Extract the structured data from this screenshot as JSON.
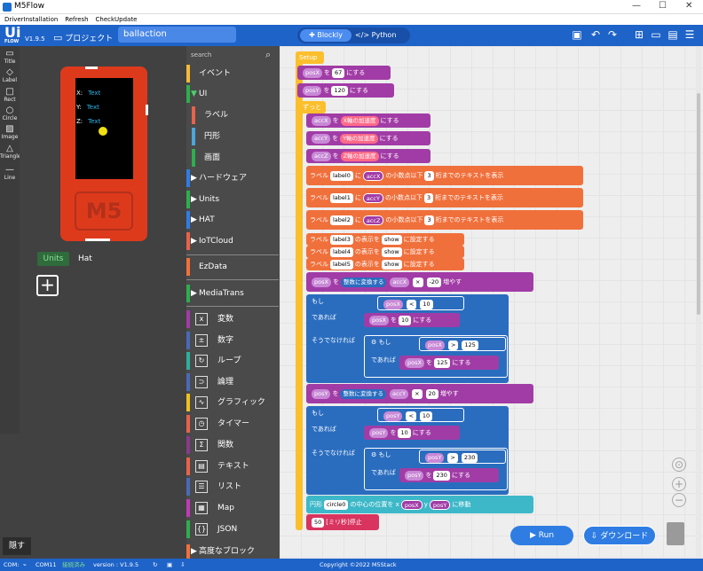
{
  "window": {
    "title": "M5Flow",
    "min": "—",
    "max": "☐",
    "close": "✕"
  },
  "menu": [
    "DriverInstallation",
    "Refresh",
    "CheckUpdate"
  ],
  "header": {
    "logo": "Ui",
    "logo_sub": "FLOW",
    "version": "V1.9.5",
    "project_label": "プロジェクト",
    "project_name": "ballaction",
    "blockly": "Blockly",
    "python": "Python"
  },
  "tools": [
    "Title",
    "Label",
    "Rect",
    "Circle",
    "Image",
    "Triangle",
    "Line"
  ],
  "device": {
    "labels": [
      {
        "k": "X:",
        "v": "Text"
      },
      {
        "k": "Y:",
        "v": "Text"
      },
      {
        "k": "Z:",
        "v": "Text"
      }
    ],
    "brand": "M5"
  },
  "tabs": {
    "units": "Units",
    "hat": "Hat"
  },
  "hide_label": "隠す",
  "search_placeholder": "search",
  "categories": [
    {
      "label": "イベント",
      "color": "#f5b83a"
    },
    {
      "label": "UI",
      "color": "#2fae4d",
      "expand": "▼"
    },
    {
      "label": "ラベル",
      "color": "#e8634a",
      "sub": true
    },
    {
      "label": "円形",
      "color": "#4ea6d9",
      "sub": true
    },
    {
      "label": "画面",
      "color": "#2fae4d",
      "sub": true
    },
    {
      "label": "ハードウェア",
      "color": "#2f7de3",
      "expand": "▶"
    },
    {
      "label": "Units",
      "color": "#2fae4d",
      "expand": "▶"
    },
    {
      "label": "HAT",
      "color": "#2f7de3",
      "expand": "▶"
    },
    {
      "label": "IoTCloud",
      "color": "#e8634a",
      "expand": "▶"
    },
    {
      "label": "EzData",
      "color": "#f0703c"
    },
    {
      "label": "MediaTrans",
      "color": "#2fae4d",
      "expand": "▶"
    },
    {
      "label": "変数",
      "color": "#a13ca6",
      "icon": "x"
    },
    {
      "label": "数字",
      "color": "#4a6ab8",
      "icon": "±"
    },
    {
      "label": "ループ",
      "color": "#2fae9c",
      "icon": "↻"
    },
    {
      "label": "論理",
      "color": "#4a6ab8",
      "icon": "⊃"
    },
    {
      "label": "グラフィック",
      "color": "#f0c020",
      "icon": "∿"
    },
    {
      "label": "タイマー",
      "color": "#e8634a",
      "icon": "◷"
    },
    {
      "label": "関数",
      "color": "#8a3a8a",
      "icon": "Σ"
    },
    {
      "label": "テキスト",
      "color": "#e8634a",
      "icon": "▤"
    },
    {
      "label": "リスト",
      "color": "#4a6ab8",
      "icon": "☰"
    },
    {
      "label": "Map",
      "color": "#c03ab8",
      "icon": "▦"
    },
    {
      "label": "JSON",
      "color": "#2fae4d",
      "icon": "{}"
    },
    {
      "label": "高度なブロック",
      "color": "#f0703c",
      "expand": "▶"
    }
  ],
  "blocks": {
    "setup": "Setup",
    "posX_init": {
      "var": "posX",
      "op": "を",
      "val": "67",
      "act": "にする"
    },
    "posY_init": {
      "var": "posY",
      "op": "を",
      "val": "120",
      "act": "にする"
    },
    "loop": "ずっと",
    "acc": [
      {
        "var": "accX",
        "op": "を",
        "val": "X軸の加速度",
        "act": "にする"
      },
      {
        "var": "accY",
        "op": "を",
        "val": "Y軸の加速度",
        "act": "にする"
      },
      {
        "var": "accZ",
        "op": "を",
        "val": "Z軸の加速度",
        "act": "にする"
      }
    ],
    "label_set": [
      {
        "pre": "ラベル",
        "name": "label0",
        "ni": "に",
        "v": "accX",
        "mid": "の小数点以下",
        "n": "3",
        "post": "桁までのテキスト",
        "end": "を表示"
      },
      {
        "pre": "ラベル",
        "name": "label1",
        "ni": "に",
        "v": "accY",
        "mid": "の小数点以下",
        "n": "3",
        "post": "桁までのテキスト",
        "end": "を表示"
      },
      {
        "pre": "ラベル",
        "name": "label2",
        "ni": "に",
        "v": "accZ",
        "mid": "の小数点以下",
        "n": "3",
        "post": "桁までのテキスト",
        "end": "を表示"
      }
    ],
    "label_show": [
      {
        "pre": "ラベル",
        "name": "label3",
        "mid": "の表示を",
        "v": "show",
        "end": "に設定する"
      },
      {
        "pre": "ラベル",
        "name": "label4",
        "mid": "の表示を",
        "v": "show",
        "end": "に設定する"
      },
      {
        "pre": "ラベル",
        "name": "label5",
        "mid": "の表示を",
        "v": "show",
        "end": "に設定する"
      }
    ],
    "incX": {
      "var": "posX",
      "op": "を",
      "conv": "整数に変換する",
      "acc": "accX",
      "mul": "×",
      "k": "-20",
      "act": "増やす"
    },
    "ifX": {
      "if": "もし",
      "var": "posX",
      "cmp": "<",
      "v": "10",
      "then": "であれば",
      "set_var": "posX",
      "set_op": "を",
      "set_v": "10",
      "act": "にする",
      "else": "そうでなければ",
      "if2": "もし",
      "cmp2": ">",
      "v2": "125",
      "then2": "であれば",
      "set_v2": "125"
    },
    "incY": {
      "var": "posY",
      "op": "を",
      "conv": "整数に変換する",
      "acc": "accY",
      "mul": "×",
      "k": "20",
      "act": "増やす"
    },
    "ifY": {
      "if": "もし",
      "var": "posY",
      "cmp": "<",
      "v": "10",
      "then": "であれば",
      "set_var": "posY",
      "set_op": "を",
      "set_v": "10",
      "act": "にする",
      "else": "そうでなければ",
      "if2": "もし",
      "cmp2": ">",
      "v2": "230",
      "then2": "であれば",
      "set_v2": "230"
    },
    "circle": {
      "pre": "円形",
      "name": "circle0",
      "mid": "の中心の位置を x",
      "x": "posX",
      "y_label": "y",
      "y": "posY",
      "end": "に移動"
    },
    "wait": {
      "v": "50",
      "unit": "[ミリ秒]停止"
    }
  },
  "run": "Run",
  "download": "ダウンロード",
  "status": {
    "com": "COM:",
    "port": "COM11",
    "connected": "接続済み",
    "version": "version : V1.9.5",
    "copyright": "Copyright ©2022 M5Stack"
  }
}
